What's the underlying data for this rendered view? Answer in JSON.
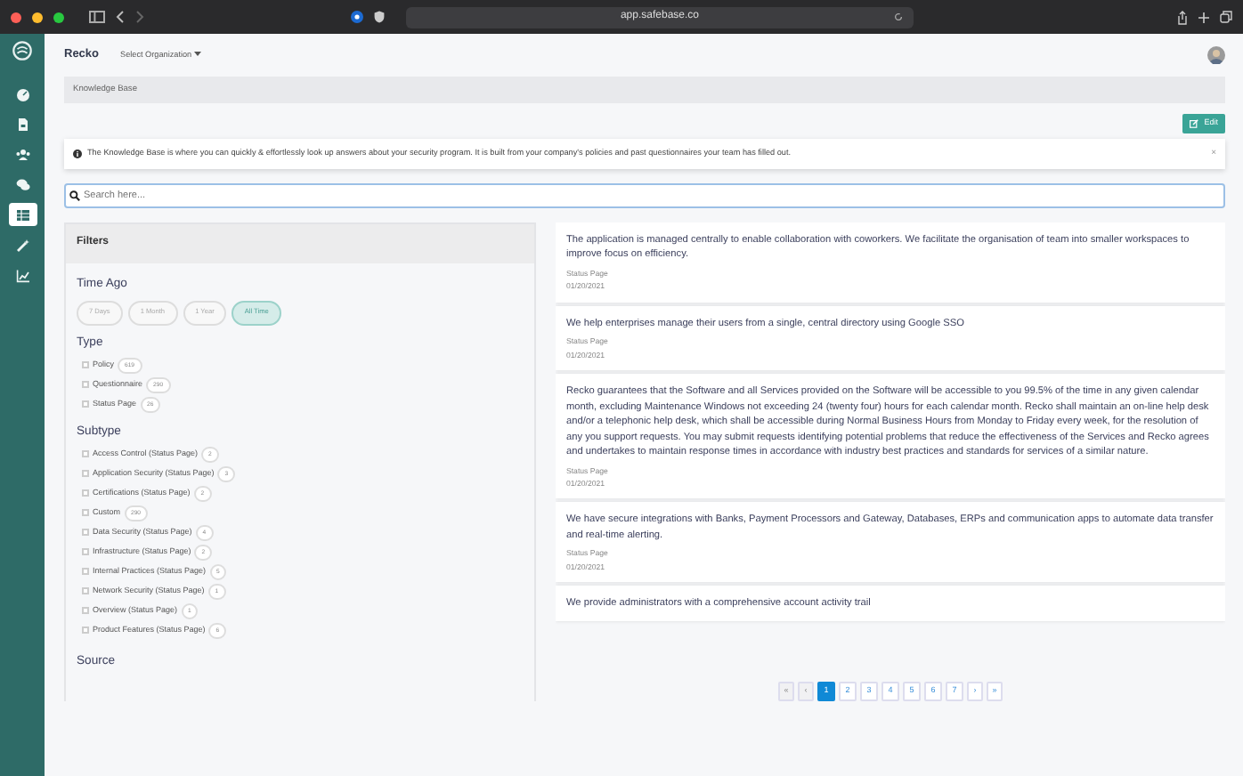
{
  "browser": {
    "url": "app.safebase.co"
  },
  "sidebar": {
    "items": [
      {
        "kind": "dashboard",
        "selected": false
      },
      {
        "kind": "document",
        "selected": false
      },
      {
        "kind": "users",
        "selected": false
      },
      {
        "kind": "chat",
        "selected": false
      },
      {
        "kind": "table",
        "selected": true
      },
      {
        "kind": "wand",
        "selected": false
      },
      {
        "kind": "chart",
        "selected": false
      }
    ]
  },
  "topbar": {
    "brand": "Recko",
    "org_menu": "Select Organization"
  },
  "breadcrumb": "Knowledge Base",
  "edit_button": "Edit",
  "info_alert": {
    "text": "The Knowledge Base is where you can quickly & effortlessly look up answers about your security program. It is built from your company's policies and past questionnaires your team has filled out.",
    "close": "×"
  },
  "search": {
    "placeholder": "Search here..."
  },
  "filters": {
    "title": "Filters",
    "time_ago": {
      "heading": "Time Ago",
      "options": [
        {
          "label": "7 Days",
          "selected": false
        },
        {
          "label": "1 Month",
          "selected": false
        },
        {
          "label": "1 Year",
          "selected": false
        },
        {
          "label": "All Time",
          "selected": true
        }
      ]
    },
    "type": {
      "heading": "Type",
      "items": [
        {
          "label": "Policy",
          "count": "619",
          "checked": false
        },
        {
          "label": "Questionnaire",
          "count": "290",
          "checked": false
        },
        {
          "label": "Status Page",
          "count": "26",
          "checked": false
        }
      ]
    },
    "subtype": {
      "heading": "Subtype",
      "items": [
        {
          "label": "Access Control (Status Page)",
          "count": "2",
          "checked": false
        },
        {
          "label": "Application Security (Status Page)",
          "count": "3",
          "checked": false
        },
        {
          "label": "Certifications (Status Page)",
          "count": "2",
          "checked": false
        },
        {
          "label": "Custom",
          "count": "290",
          "checked": false
        },
        {
          "label": "Data Security (Status Page)",
          "count": "4",
          "checked": false
        },
        {
          "label": "Infrastructure (Status Page)",
          "count": "2",
          "checked": false
        },
        {
          "label": "Internal Practices (Status Page)",
          "count": "5",
          "checked": false
        },
        {
          "label": "Network Security (Status Page)",
          "count": "1",
          "checked": false
        },
        {
          "label": "Overview (Status Page)",
          "count": "1",
          "checked": false
        },
        {
          "label": "Product Features (Status Page)",
          "count": "6",
          "checked": false
        }
      ]
    },
    "source": {
      "heading": "Source"
    }
  },
  "results": [
    {
      "text": "The application is managed centrally to enable collaboration with coworkers. We facilitate the organisation of team into smaller workspaces to improve focus on efficiency.",
      "type": "Status Page",
      "date": "01/20/2021"
    },
    {
      "text": "We help enterprises manage their users from a single, central directory using Google SSO",
      "type": "Status Page",
      "date": "01/20/2021"
    },
    {
      "text": "Recko guarantees that the Software and all Services provided on the Software will be accessible to you 99.5% of the time in any given calendar month, excluding Maintenance Windows not exceeding 24 (twenty four) hours for each calendar month. Recko shall maintain an on-line help desk and/or a telephonic help desk, which shall be accessible during Normal Business Hours from Monday to Friday every week, for the resolution of any you support requests. You may submit requests identifying potential problems that reduce the effectiveness of the Services and Recko agrees and undertakes to maintain response times in accordance with industry best practices and standards for services of a similar nature.",
      "type": "Status Page",
      "date": "01/20/2021"
    },
    {
      "text": "We have secure integrations with Banks, Payment Processors and Gateway, Databases, ERPs and communication apps to automate data transfer and real-time alerting.",
      "type": "Status Page",
      "date": "01/20/2021"
    },
    {
      "text": "We provide administrators with a comprehensive account activity trail"
    }
  ],
  "pagination": [
    {
      "label": "«",
      "kind": "nav",
      "disabled": true,
      "selected": false
    },
    {
      "label": "‹",
      "kind": "nav",
      "disabled": true,
      "selected": false
    },
    {
      "label": "1",
      "kind": "page",
      "disabled": false,
      "selected": true
    },
    {
      "label": "2",
      "kind": "page",
      "disabled": false,
      "selected": false
    },
    {
      "label": "3",
      "kind": "page",
      "disabled": false,
      "selected": false
    },
    {
      "label": "4",
      "kind": "page",
      "disabled": false,
      "selected": false
    },
    {
      "label": "5",
      "kind": "page",
      "disabled": false,
      "selected": false
    },
    {
      "label": "6",
      "kind": "page",
      "disabled": false,
      "selected": false
    },
    {
      "label": "7",
      "kind": "page",
      "disabled": false,
      "selected": false
    },
    {
      "label": "›",
      "kind": "nav",
      "disabled": false,
      "selected": false
    },
    {
      "label": "»",
      "kind": "nav",
      "disabled": false,
      "selected": false
    }
  ]
}
